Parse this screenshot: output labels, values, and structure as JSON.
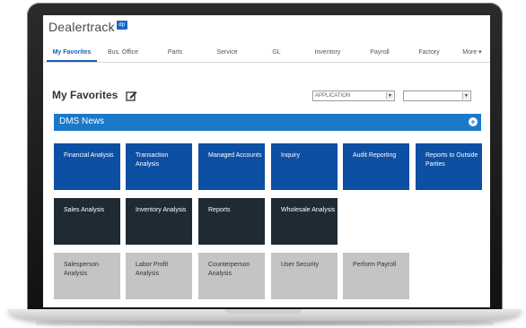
{
  "app": {
    "logo_text": "Dealertrack",
    "logo_mark": "dp"
  },
  "nav": {
    "items": [
      {
        "label": "My Favorites",
        "active": true
      },
      {
        "label": "Bus. Office",
        "active": false
      },
      {
        "label": "Parts",
        "active": false
      },
      {
        "label": "Service",
        "active": false
      },
      {
        "label": "GL",
        "active": false
      },
      {
        "label": "Inventory",
        "active": false
      },
      {
        "label": "Payroll",
        "active": false
      },
      {
        "label": "Factory",
        "active": false
      },
      {
        "label": "More ▾",
        "active": false
      }
    ]
  },
  "page": {
    "title": "My Favorites",
    "select_primary": "APPLICATION",
    "select_secondary": ""
  },
  "dms": {
    "title": "DMS News",
    "add_icon": "plus-circle-icon"
  },
  "tiles": {
    "row1": [
      "Financial Analysis",
      "Transaction Analysis",
      "Managed Accounts",
      "Inquiry",
      "Audit Reporting",
      "Reports to Outside Parties"
    ],
    "row2": [
      "Sales Analysis",
      "Inventory Analysis",
      "Reports",
      "Wholesale Analysis"
    ],
    "row3": [
      "Salesperson Analysis",
      "Labor Profit Analysis",
      "Counterperson Analysis",
      "User Security",
      "Perform Payroll"
    ]
  },
  "colors": {
    "tile_blue": "#0d4fa3",
    "tile_dark": "#1f2a33",
    "tile_gray": "#c4c4c4",
    "banner_blue": "#1c78c9",
    "nav_active": "#1a5fb4"
  }
}
